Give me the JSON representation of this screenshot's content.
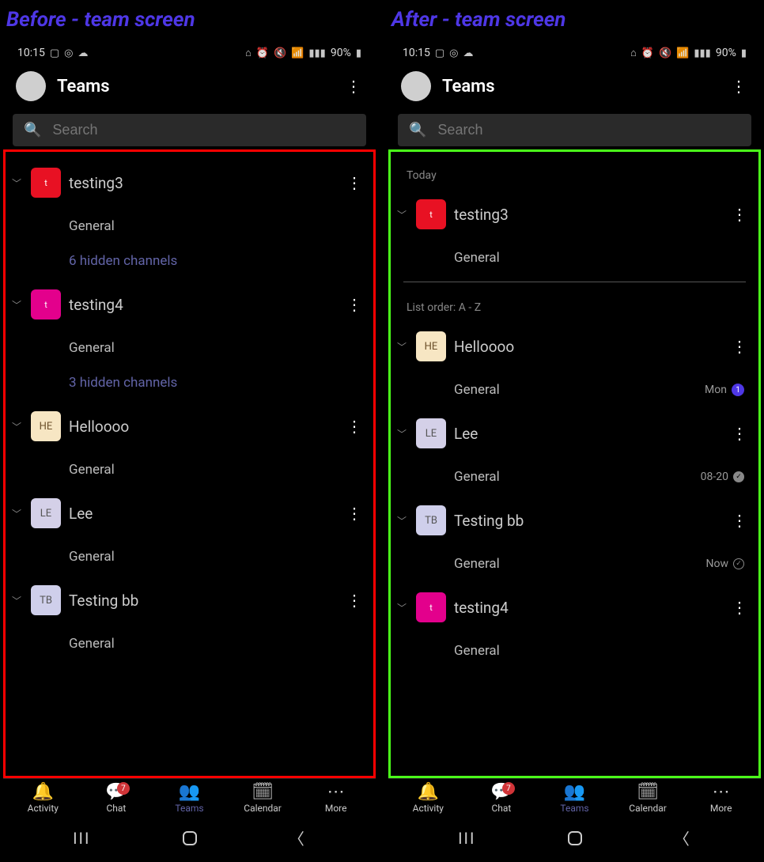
{
  "labels": {
    "before": "Before - team screen",
    "after": "After - team screen"
  },
  "status": {
    "time": "10:15",
    "battery_text": "90%"
  },
  "header": {
    "title": "Teams"
  },
  "search": {
    "placeholder": "Search"
  },
  "before": {
    "teams": [
      {
        "name": "testing3",
        "initials": "t",
        "color": "red",
        "channels": [
          {
            "name": "General"
          }
        ],
        "hidden": "6 hidden channels"
      },
      {
        "name": "testing4",
        "initials": "t",
        "color": "magenta",
        "channels": [
          {
            "name": "General"
          }
        ],
        "hidden": "3 hidden channels"
      },
      {
        "name": "Helloooo",
        "initials": "HE",
        "color": "cream",
        "channels": [
          {
            "name": "General"
          }
        ]
      },
      {
        "name": "Lee",
        "initials": "LE",
        "color": "lav",
        "channels": [
          {
            "name": "General"
          }
        ]
      },
      {
        "name": "Testing bb",
        "initials": "TB",
        "color": "lblue",
        "channels": [
          {
            "name": "General"
          }
        ]
      }
    ]
  },
  "after": {
    "section_today": "Today",
    "section_order": "List order: A - Z",
    "today_team": {
      "name": "testing3",
      "initials": "t",
      "color": "red",
      "channels": [
        {
          "name": "General"
        }
      ]
    },
    "teams": [
      {
        "name": "Helloooo",
        "initials": "HE",
        "color": "cream",
        "channels": [
          {
            "name": "General",
            "meta_text": "Mon",
            "badge": "1"
          }
        ]
      },
      {
        "name": "Lee",
        "initials": "LE",
        "color": "lav",
        "channels": [
          {
            "name": "General",
            "meta_text": "08-20",
            "check": "filled"
          }
        ]
      },
      {
        "name": "Testing bb",
        "initials": "TB",
        "color": "lblue",
        "channels": [
          {
            "name": "General",
            "meta_text": "Now",
            "check": "outline"
          }
        ]
      },
      {
        "name": "testing4",
        "initials": "t",
        "color": "magenta",
        "channels": [
          {
            "name": "General"
          }
        ]
      }
    ]
  },
  "nav": {
    "items": [
      {
        "label": "Activity",
        "icon": "bell"
      },
      {
        "label": "Chat",
        "icon": "chat",
        "badge": "7"
      },
      {
        "label": "Teams",
        "icon": "teams",
        "active": true
      },
      {
        "label": "Calendar",
        "icon": "calendar"
      },
      {
        "label": "More",
        "icon": "more"
      }
    ]
  }
}
